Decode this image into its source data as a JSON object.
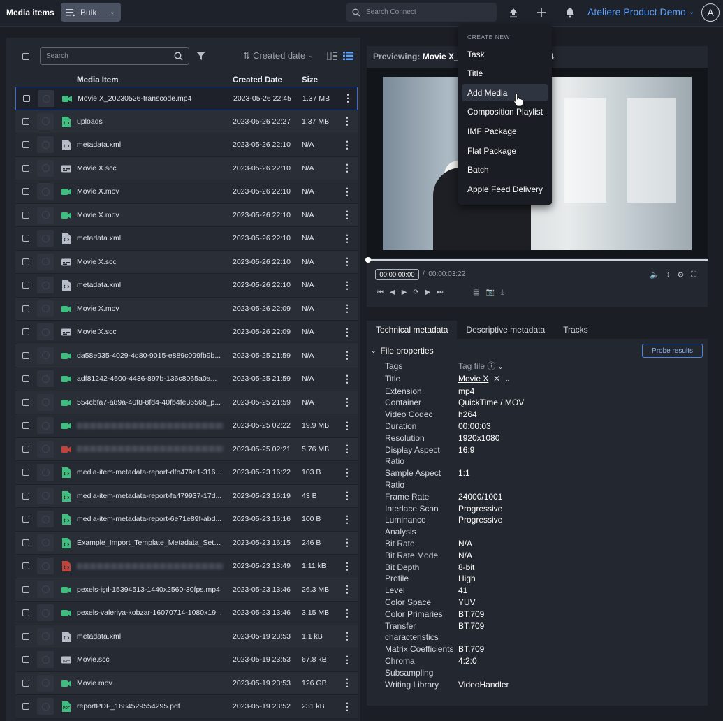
{
  "header": {
    "app_title": "Media items",
    "bulk_label": "Bulk",
    "search_placeholder": "Search Connect",
    "workspace": "Ateliere Product Demo",
    "avatar_letter": "A"
  },
  "list": {
    "search_placeholder": "Search",
    "sort_label": "Created date",
    "columns": {
      "media_item": "Media Item",
      "created_date": "Created Date",
      "size": "Size"
    },
    "rows": [
      {
        "name": "Movie X_20230526-transcode.mp4",
        "date": "2023-05-26 22:45",
        "size": "1.37 MB",
        "icon": "video-icon"
      },
      {
        "name": "uploads",
        "date": "2023-05-26 22:27",
        "size": "1.37 MB",
        "icon": "file-upload-icon"
      },
      {
        "name": "metadata.xml",
        "date": "2023-05-26 22:10",
        "size": "N/A",
        "icon": "xml-file-icon"
      },
      {
        "name": "Movie X.scc",
        "date": "2023-05-26 22:10",
        "size": "N/A",
        "icon": "caption-icon"
      },
      {
        "name": "Movie X.mov",
        "date": "2023-05-26 22:10",
        "size": "N/A",
        "icon": "video-icon"
      },
      {
        "name": "Movie X.mov",
        "date": "2023-05-26 22:10",
        "size": "N/A",
        "icon": "video-icon"
      },
      {
        "name": "metadata.xml",
        "date": "2023-05-26 22:10",
        "size": "N/A",
        "icon": "xml-file-icon"
      },
      {
        "name": "Movie X.scc",
        "date": "2023-05-26 22:10",
        "size": "N/A",
        "icon": "caption-icon"
      },
      {
        "name": "metadata.xml",
        "date": "2023-05-26 22:10",
        "size": "N/A",
        "icon": "xml-file-icon"
      },
      {
        "name": "Movie X.mov",
        "date": "2023-05-26 22:09",
        "size": "N/A",
        "icon": "video-icon"
      },
      {
        "name": "Movie X.scc",
        "date": "2023-05-26 22:09",
        "size": "N/A",
        "icon": "caption-icon"
      },
      {
        "name": "da58e935-4029-4d80-9015-e889c099fb9b...",
        "date": "2023-05-25 21:59",
        "size": "N/A",
        "icon": "video-icon"
      },
      {
        "name": "adf81242-4600-4436-897b-136c8065a0a...",
        "date": "2023-05-25 21:59",
        "size": "N/A",
        "icon": "video-icon"
      },
      {
        "name": "554cbfa7-a89a-40f8-8fd4-40fb4fe3656b_p...",
        "date": "2023-05-25 21:59",
        "size": "N/A",
        "icon": "video-icon"
      },
      {
        "name": "",
        "date": "2023-05-25 02:22",
        "size": "19.9 MB",
        "icon": "video-icon",
        "blurred": true
      },
      {
        "name": "",
        "date": "2023-05-25 02:21",
        "size": "5.76 MB",
        "icon": "video-error-icon",
        "blurred": true
      },
      {
        "name": "media-item-metadata-report-dfb479e1-316...",
        "date": "2023-05-23 16:22",
        "size": "103 B",
        "icon": "report-file-icon"
      },
      {
        "name": "media-item-metadata-report-fa479937-17d...",
        "date": "2023-05-23 16:19",
        "size": "43 B",
        "icon": "report-file-icon"
      },
      {
        "name": "media-item-metadata-report-6e71e89f-abd...",
        "date": "2023-05-23 16:16",
        "size": "100 B",
        "icon": "report-file-icon"
      },
      {
        "name": "Example_Import_Template_Metadata_Sets (7...",
        "date": "2023-05-23 16:15",
        "size": "246 B",
        "icon": "report-file-icon"
      },
      {
        "name": "",
        "date": "2023-05-23 13:49",
        "size": "1.11 kB",
        "icon": "file-error-icon",
        "blurred": true
      },
      {
        "name": "pexels-işıl-15394513-1440x2560-30fps.mp4",
        "date": "2023-05-23 13:46",
        "size": "26.3 MB",
        "icon": "video-icon"
      },
      {
        "name": "pexels-valeriya-kobzar-16070714-1080x19...",
        "date": "2023-05-23 13:46",
        "size": "3.15 MB",
        "icon": "video-icon"
      },
      {
        "name": "metadata.xml",
        "date": "2023-05-19 23:53",
        "size": "1.1 kB",
        "icon": "xml-file-icon"
      },
      {
        "name": "Movie.scc",
        "date": "2023-05-19 23:53",
        "size": "67.8 kB",
        "icon": "caption-icon"
      },
      {
        "name": "Movie.mov",
        "date": "2023-05-19 23:53",
        "size": "126 GB",
        "icon": "video-icon"
      },
      {
        "name": "reportPDF_1684529554295.pdf",
        "date": "2023-05-19 23:52",
        "size": "231 kB",
        "icon": "pdf-icon"
      }
    ]
  },
  "preview": {
    "label": "Previewing:",
    "title": "Movie X_2",
    "title_tail": "4",
    "timecode": "00:00:00:00",
    "duration": "00:00:03:22"
  },
  "metadata": {
    "tabs": [
      "Technical metadata",
      "Descriptive metadata",
      "Tracks"
    ],
    "section": "File properties",
    "probe_button": "Probe results",
    "rows": [
      {
        "k": "Tags",
        "v": "Tag file",
        "style": "muted"
      },
      {
        "k": "Title",
        "v": "Movie X",
        "style": "link"
      },
      {
        "k": "Extension",
        "v": "mp4"
      },
      {
        "k": "Container",
        "v": "QuickTime / MOV"
      },
      {
        "k": "Video Codec",
        "v": "h264"
      },
      {
        "k": "Duration",
        "v": "00:00:03"
      },
      {
        "k": "Resolution",
        "v": "1920x1080"
      },
      {
        "k": "Display Aspect Ratio",
        "v": "16:9"
      },
      {
        "k": "Sample Aspect Ratio",
        "v": "1:1"
      },
      {
        "k": "Frame Rate",
        "v": "24000/1001"
      },
      {
        "k": "Interlace Scan",
        "v": "Progressive"
      },
      {
        "k": "Luminance Analysis",
        "v": "Progressive"
      },
      {
        "k": "Bit Rate",
        "v": "N/A"
      },
      {
        "k": "Bit Rate Mode",
        "v": "N/A"
      },
      {
        "k": "Bit Depth",
        "v": "8-bit"
      },
      {
        "k": "Profile",
        "v": "High"
      },
      {
        "k": "Level",
        "v": "41"
      },
      {
        "k": "Color Space",
        "v": "YUV"
      },
      {
        "k": "Color Primaries",
        "v": "BT.709"
      },
      {
        "k": "Transfer characteristics",
        "v": "BT.709"
      },
      {
        "k": "Matrix Coefficients",
        "v": "BT.709"
      },
      {
        "k": "Chroma Subsampling",
        "v": "4:2:0"
      },
      {
        "k": "Writing Library",
        "v": "VideoHandler"
      }
    ]
  },
  "create_menu": {
    "heading": "CREATE NEW",
    "items": [
      "Task",
      "Title",
      "Add Media",
      "Composition Playlist",
      "IMF Package",
      "Flat Package",
      "Batch",
      "Apple Feed Delivery"
    ],
    "hovered_index": 2
  },
  "colors": {
    "accent": "#4a86e8",
    "video_icon": "#3fbf7f",
    "error_icon": "#c0443b",
    "workspace": "#5aa0ff"
  }
}
